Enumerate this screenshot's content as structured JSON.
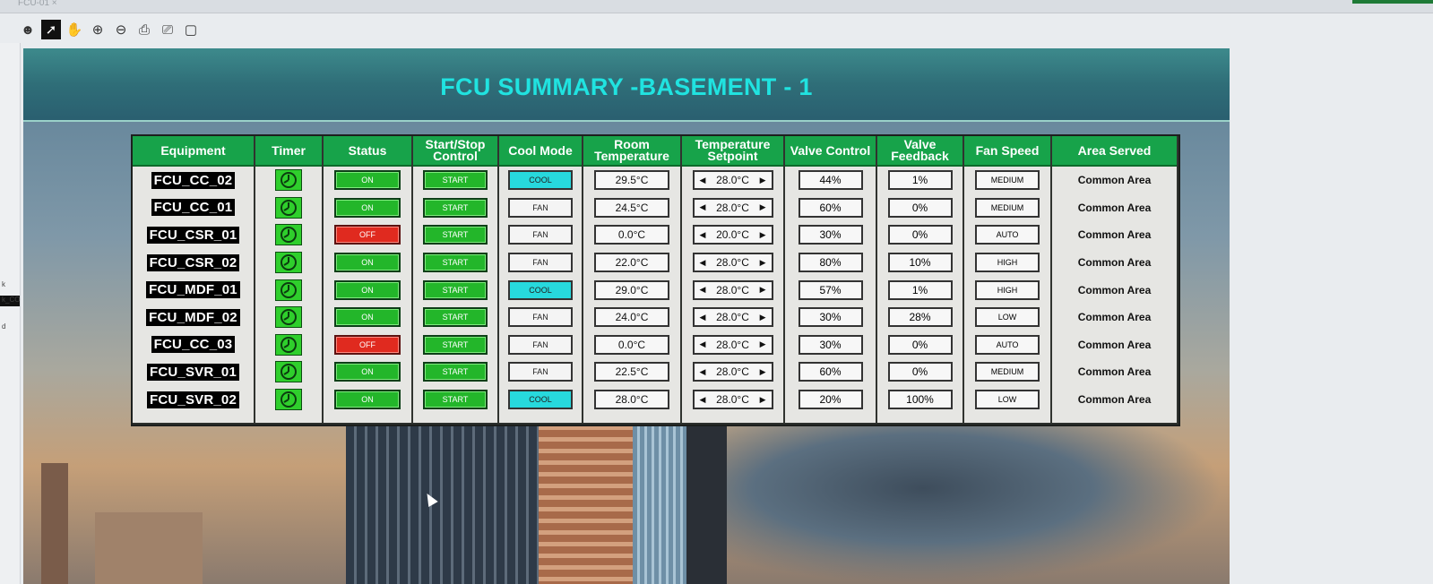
{
  "window": {
    "tab_label": "FCU-01 ×"
  },
  "toolbar": {
    "icons": [
      "user-icon",
      "pointer-icon",
      "hand-icon",
      "zoom-in-icon",
      "zoom-out-icon",
      "print-icon",
      "print-preview-icon",
      "page-icon"
    ]
  },
  "left_panel": {
    "labels": [
      "k",
      "k_CO",
      "d"
    ]
  },
  "title": "FCU SUMMARY -BASEMENT - 1",
  "headers": {
    "equipment": "Equipment",
    "timer": "Timer",
    "status": "Status",
    "control": "Start/Stop Control",
    "mode": "Cool Mode",
    "room_temp": "Room Temperature",
    "setpoint": "Temperature Setpoint",
    "valve_control": "Valve Control",
    "valve_feedback": "Valve Feedback",
    "fan_speed": "Fan Speed",
    "area": "Area Served"
  },
  "arrows": {
    "left": "◀",
    "right": "▶"
  },
  "rows": [
    {
      "equipment": "FCU_CC_02",
      "status": "ON",
      "control": "START",
      "mode": "COOL",
      "room_temp": "29.5°C",
      "setpoint": "28.0°C",
      "valve_control": "44%",
      "valve_feedback": "1%",
      "fan": "MEDIUM",
      "area": "Common Area"
    },
    {
      "equipment": "FCU_CC_01",
      "status": "ON",
      "control": "START",
      "mode": "FAN",
      "room_temp": "24.5°C",
      "setpoint": "28.0°C",
      "valve_control": "60%",
      "valve_feedback": "0%",
      "fan": "MEDIUM",
      "area": "Common Area"
    },
    {
      "equipment": "FCU_CSR_01",
      "status": "OFF",
      "control": "START",
      "mode": "FAN",
      "room_temp": "0.0°C",
      "setpoint": "20.0°C",
      "valve_control": "30%",
      "valve_feedback": "0%",
      "fan": "AUTO",
      "area": "Common Area"
    },
    {
      "equipment": "FCU_CSR_02",
      "status": "ON",
      "control": "START",
      "mode": "FAN",
      "room_temp": "22.0°C",
      "setpoint": "28.0°C",
      "valve_control": "80%",
      "valve_feedback": "10%",
      "fan": "HIGH",
      "area": "Common Area"
    },
    {
      "equipment": "FCU_MDF_01",
      "status": "ON",
      "control": "START",
      "mode": "COOL",
      "room_temp": "29.0°C",
      "setpoint": "28.0°C",
      "valve_control": "57%",
      "valve_feedback": "1%",
      "fan": "HIGH",
      "area": "Common Area"
    },
    {
      "equipment": "FCU_MDF_02",
      "status": "ON",
      "control": "START",
      "mode": "FAN",
      "room_temp": "24.0°C",
      "setpoint": "28.0°C",
      "valve_control": "30%",
      "valve_feedback": "28%",
      "fan": "LOW",
      "area": "Common Area"
    },
    {
      "equipment": "FCU_CC_03",
      "status": "OFF",
      "control": "START",
      "mode": "FAN",
      "room_temp": "0.0°C",
      "setpoint": "28.0°C",
      "valve_control": "30%",
      "valve_feedback": "0%",
      "fan": "AUTO",
      "area": "Common Area"
    },
    {
      "equipment": "FCU_SVR_01",
      "status": "ON",
      "control": "START",
      "mode": "FAN",
      "room_temp": "22.5°C",
      "setpoint": "28.0°C",
      "valve_control": "60%",
      "valve_feedback": "0%",
      "fan": "MEDIUM",
      "area": "Common Area"
    },
    {
      "equipment": "FCU_SVR_02",
      "status": "ON",
      "control": "START",
      "mode": "COOL",
      "room_temp": "28.0°C",
      "setpoint": "28.0°C",
      "valve_control": "20%",
      "valve_feedback": "100%",
      "fan": "LOW",
      "area": "Common Area"
    }
  ],
  "colors": {
    "header_green": "#17a34a",
    "title_cyan": "#20e3e0",
    "on_green": "#23b62a",
    "off_red": "#e02a1f",
    "cool_cyan": "#27d9dd"
  }
}
